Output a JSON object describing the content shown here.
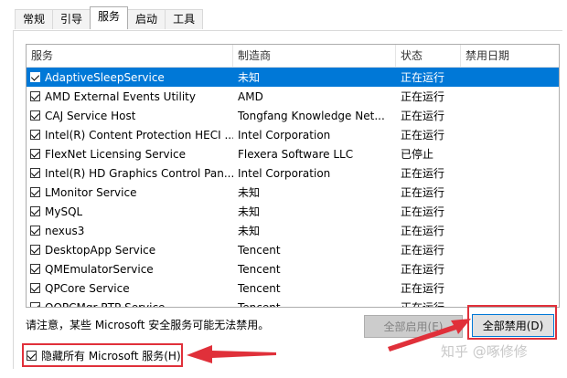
{
  "tabs": [
    "常规",
    "引导",
    "服务",
    "启动",
    "工具"
  ],
  "active_tab": 2,
  "columns": [
    "服务",
    "制造商",
    "状态",
    "禁用日期"
  ],
  "services": [
    {
      "name": "AdaptiveSleepService",
      "maker": "未知",
      "status": "正在运行",
      "checked": true,
      "selected": true
    },
    {
      "name": "AMD External Events Utility",
      "maker": "AMD",
      "status": "正在运行",
      "checked": true
    },
    {
      "name": "CAJ Service Host",
      "maker": "Tongfang Knowledge Net...",
      "status": "正在运行",
      "checked": true
    },
    {
      "name": "Intel(R) Content Protection HECI ...",
      "maker": "Intel Corporation",
      "status": "正在运行",
      "checked": true
    },
    {
      "name": "FlexNet Licensing Service",
      "maker": "Flexera Software LLC",
      "status": "已停止",
      "checked": true
    },
    {
      "name": "Intel(R) HD Graphics Control Pan...",
      "maker": "Intel Corporation",
      "status": "正在运行",
      "checked": true
    },
    {
      "name": "LMonitor Service",
      "maker": "未知",
      "status": "正在运行",
      "checked": true
    },
    {
      "name": "MySQL",
      "maker": "未知",
      "status": "正在运行",
      "checked": true
    },
    {
      "name": "nexus3",
      "maker": "未知",
      "status": "正在运行",
      "checked": true
    },
    {
      "name": "DesktopApp Service",
      "maker": "Tencent",
      "status": "正在运行",
      "checked": true
    },
    {
      "name": "QMEmulatorService",
      "maker": "Tencent",
      "status": "正在运行",
      "checked": true
    },
    {
      "name": "QPCore Service",
      "maker": "Tencent",
      "status": "正在运行",
      "checked": true
    },
    {
      "name": "QQPCMgr RTP Service",
      "maker": "Tencent",
      "status": "正在运行",
      "checked": true
    }
  ],
  "note": "请注意，某些 Microsoft 安全服务可能无法禁用。",
  "enable_all_label": "全部启用(E)",
  "disable_all_label": "全部禁用(D)",
  "hide_ms_label": "隐藏所有 Microsoft 服务(H)",
  "hide_ms_checked": true,
  "watermark": "知乎 @啄修修",
  "colors": {
    "selection": "#0078d7",
    "annotation": "#e0303a"
  }
}
